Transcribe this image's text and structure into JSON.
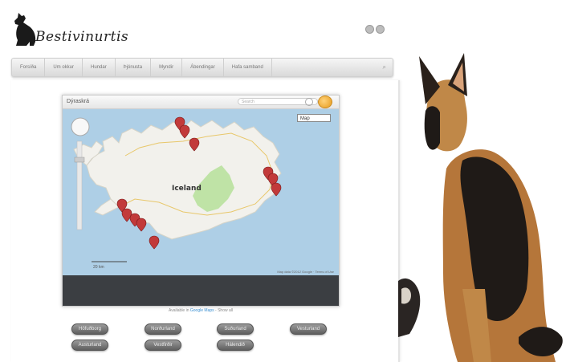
{
  "header": {
    "site_title": "Bestivinurtis"
  },
  "navbar": {
    "items": [
      "Forsíða",
      "Um okkur",
      "Hundar",
      "Þjónusta",
      "Myndir",
      "Ábendingar",
      "Hafa samband"
    ],
    "search_glyph": "⌕"
  },
  "map_widget": {
    "title": "Dýraskrá",
    "search_placeholder": "Search",
    "map_type_label": "Map",
    "country_label": "Iceland",
    "scale_label": "20 km",
    "copyright": "Map data ©2012 Google · Terms of Use",
    "footer_prefix": "Available in",
    "footer_link": "Google Maps",
    "footer_suffix": "- Show all"
  },
  "buttons": {
    "row1": [
      "Höfuðborg",
      "Norðurland",
      "Suðurland",
      "Vesturland"
    ],
    "row2": [
      "Austurland",
      "Vestfirðir",
      "Hálendið"
    ]
  },
  "colors": {
    "sea": "#aecfe6",
    "land": "#f2f1ec",
    "park": "#bfe3a6",
    "marker": "#c23a3a"
  },
  "icons": {
    "logo": "dog-silhouette-icon",
    "social": [
      "facebook-icon",
      "twitter-icon"
    ],
    "map_pin": "map-marker-icon"
  }
}
